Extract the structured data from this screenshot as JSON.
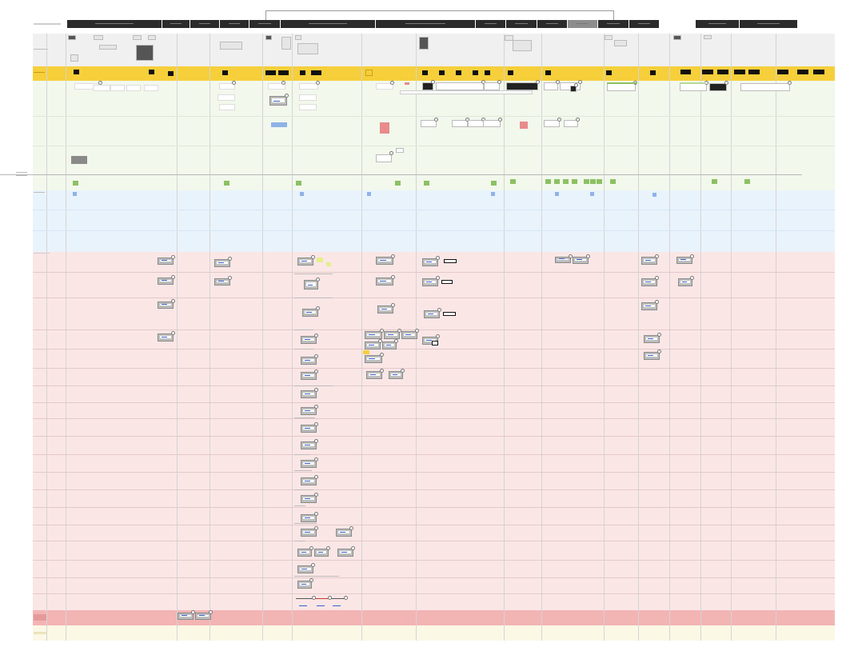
{
  "board": {
    "title": "",
    "background": "#ffffff"
  },
  "colors": {
    "header_bar": "#2b2b2b",
    "context_lane": "#f0f0f0",
    "touchpoint_lane": "#f6cf3b",
    "green_lane": "#f2f8ec",
    "blue_lane": "#e9f3fc",
    "red_lane": "#fbe6e6",
    "deep_red_lane": "#f3b4b4",
    "cream_lane": "#fcf8e6",
    "green_marker": "#8dc063",
    "blue_marker": "#8fb2e8"
  },
  "stages": [
    {
      "label": ""
    },
    {
      "label": ""
    },
    {
      "label": ""
    },
    {
      "label": ""
    },
    {
      "label": ""
    },
    {
      "label": ""
    },
    {
      "label": ""
    },
    {
      "label": ""
    },
    {
      "label": ""
    },
    {
      "label": ""
    },
    {
      "label": ""
    },
    {
      "label": ""
    },
    {
      "label": ""
    }
  ],
  "lanes": [
    {
      "name": "context",
      "label": ""
    },
    {
      "name": "touchpoints",
      "label": ""
    },
    {
      "name": "user-actions",
      "label": ""
    },
    {
      "name": "frontstage",
      "label": ""
    },
    {
      "name": "backstage",
      "label": ""
    },
    {
      "name": "pain-points",
      "label": ""
    },
    {
      "name": "opportunities",
      "label": ""
    }
  ],
  "icons": {
    "connector": "circle-connector-icon",
    "screen": "screen-thumbnail-icon",
    "note": "sticky-note-icon"
  }
}
